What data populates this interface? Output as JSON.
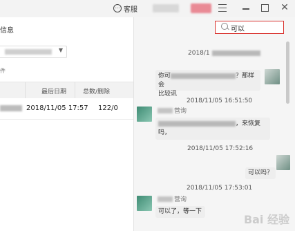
{
  "titlebar": {
    "feedback_label": "客服",
    "feedback_icon": "chat-icon",
    "menu_icon": "hamburger-icon",
    "min_icon": "minimize-icon",
    "max_icon": "maximize-icon",
    "close_symbol": "✕"
  },
  "left": {
    "title_suffix": "信息",
    "small_label": "件",
    "table": {
      "headers": [
        "最后日期",
        "总数/删除"
      ],
      "rows": [
        {
          "date": "2018/11/05 17:57",
          "count": "122/0"
        }
      ]
    }
  },
  "search": {
    "value": "可以",
    "icon": "search-icon"
  },
  "messages": [
    {
      "timestamp": "2018/1",
      "side": "right",
      "text_start": "你可",
      "text_end": "？那样会",
      "line2": "比较讯"
    },
    {
      "timestamp": "2018/11/05 16:51:50",
      "side": "left",
      "name_fragment": "营询",
      "text_end": "，来恢复",
      "line2": "吗，"
    },
    {
      "timestamp": "2018/11/05 17:52:16",
      "side": "right",
      "text": "可以吗？"
    },
    {
      "timestamp": "2018/11/05 17:53:01",
      "side": "left",
      "name_fragment": "营询",
      "text": "可以了，等一下"
    }
  ],
  "watermark": "Bai 经验"
}
